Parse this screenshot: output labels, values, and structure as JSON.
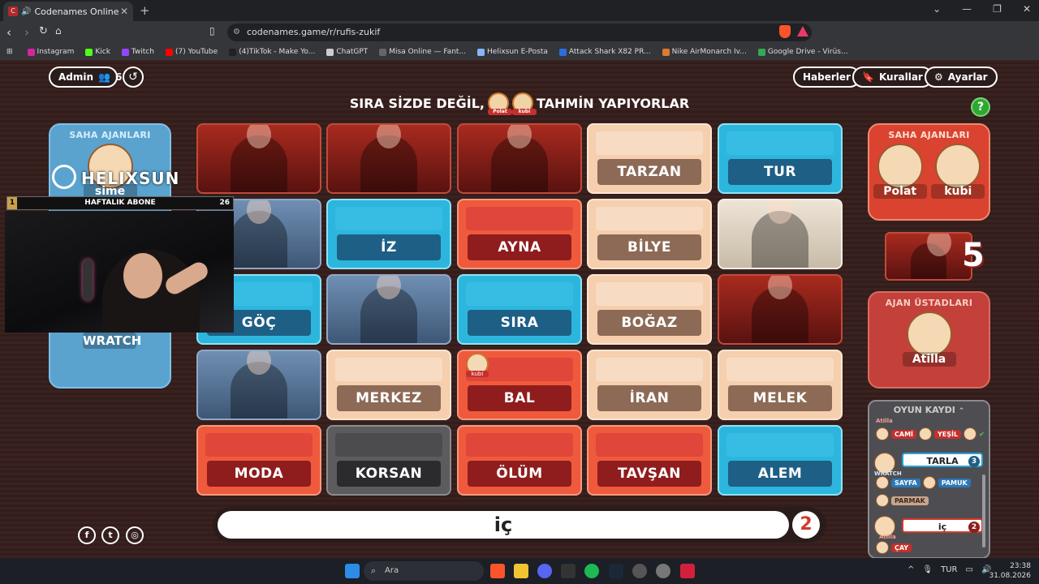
{
  "browser": {
    "tab_title": "Codenames Online",
    "url": "codenames.game/r/rufis-zukif",
    "bookmarks": [
      {
        "label": "Instagram",
        "color": "#d6249f"
      },
      {
        "label": "Kick",
        "color": "#53fc18"
      },
      {
        "label": "Twitch",
        "color": "#9146ff"
      },
      {
        "label": "(7) YouTube",
        "color": "#ff0000"
      },
      {
        "label": "(4)TikTok - Make Yo...",
        "color": "#222222"
      },
      {
        "label": "ChatGPT",
        "color": "#cccccc"
      },
      {
        "label": "Misa Online — Fant...",
        "color": "#666666"
      },
      {
        "label": "Helixsun E-Posta",
        "color": "#8ab4f8"
      },
      {
        "label": "Attack Shark X82 PR...",
        "color": "#2d6cdf"
      },
      {
        "label": "Nike AirMonarch Iv...",
        "color": "#e07a2c"
      },
      {
        "label": "Google Drive - Virüs...",
        "color": "#34a853"
      }
    ]
  },
  "header": {
    "admin_label": "Admin",
    "player_count": "6",
    "news_label": "Haberler",
    "rules_label": "Kurallar",
    "settings_label": "Ayarlar",
    "help_label": "?",
    "banner_left": "SIRA SİZDE DEĞİL,",
    "banner_right": "TAHMİN YAPIYORLAR",
    "banner_players": [
      "Polat",
      "kubi"
    ]
  },
  "blue_team": {
    "operatives_label": "SAHA AJANLARI",
    "operative_name": "sime",
    "spymaster_name": "WRATCH"
  },
  "red_team": {
    "operatives_label": "SAHA AJANLARI",
    "operatives": [
      "Polat",
      "kubi"
    ],
    "spymasters_label": "AJAN ÜSTADLARI",
    "spymaster_name": "Atilla",
    "remaining": "5"
  },
  "board": [
    {
      "word": "",
      "type": "img-red"
    },
    {
      "word": "",
      "type": "img-red"
    },
    {
      "word": "",
      "type": "img-red"
    },
    {
      "word": "TARZAN",
      "type": "beige"
    },
    {
      "word": "TUR",
      "type": "blue"
    },
    {
      "word": "",
      "type": "img-blue"
    },
    {
      "word": "İZ",
      "type": "blue"
    },
    {
      "word": "AYNA",
      "type": "red"
    },
    {
      "word": "BİLYE",
      "type": "beige"
    },
    {
      "word": "",
      "type": "img-beige"
    },
    {
      "word": "GÖÇ",
      "type": "blue"
    },
    {
      "word": "",
      "type": "img-blue"
    },
    {
      "word": "SIRA",
      "type": "blue"
    },
    {
      "word": "BOĞAZ",
      "type": "beige"
    },
    {
      "word": "",
      "type": "img-red"
    },
    {
      "word": "",
      "type": "img-blue"
    },
    {
      "word": "MERKEZ",
      "type": "beige"
    },
    {
      "word": "BAL",
      "type": "red",
      "guesser": "kubi"
    },
    {
      "word": "İRAN",
      "type": "beige"
    },
    {
      "word": "MELEK",
      "type": "beige"
    },
    {
      "word": "MODA",
      "type": "red"
    },
    {
      "word": "KORSAN",
      "type": "black"
    },
    {
      "word": "ÖLÜM",
      "type": "red"
    },
    {
      "word": "TAVŞAN",
      "type": "red"
    },
    {
      "word": "ALEM",
      "type": "blue"
    }
  ],
  "log": {
    "title": "OYUN KAYDI",
    "top_name": "Atilla",
    "row1": [
      {
        "t": "CAMİ",
        "c": "r",
        "who": "kubi"
      },
      {
        "t": "YEŞİL",
        "c": "r",
        "who": "kubi"
      }
    ],
    "clue1": {
      "giver": "WRATCH",
      "word": "TARLA",
      "count": "3"
    },
    "row2": [
      {
        "t": "SAYFA",
        "c": "b"
      },
      {
        "t": "PAMUK",
        "c": "b"
      }
    ],
    "row3": [
      {
        "t": "PARMAK",
        "c": "k"
      }
    ],
    "clue2": {
      "giver": "Atilla",
      "word": "iç",
      "count": "2"
    },
    "row4": [
      {
        "t": "ÇAY",
        "c": "r",
        "who": "Polat"
      }
    ]
  },
  "clue_bar": {
    "word": "iç",
    "count": "2"
  },
  "overlay": {
    "brand": "HELIXSUN",
    "sub_rank": "1",
    "sub_label": "HAFTALIK ABONE",
    "sub_value": "26"
  },
  "taskbar": {
    "search_label": "Ara",
    "lang": "TUR",
    "time": "23:38",
    "date": "31.08.2026"
  }
}
